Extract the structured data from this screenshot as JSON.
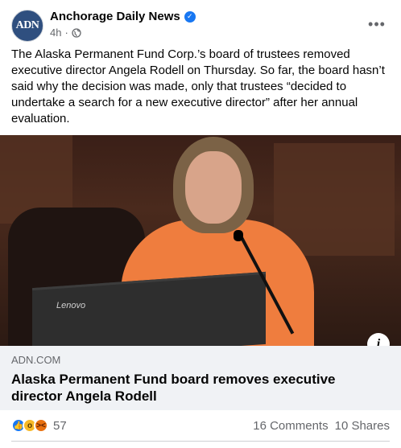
{
  "header": {
    "avatar_text": "ADN",
    "page_name": "Anchorage Daily News",
    "time": "4h",
    "separator": "·",
    "more_label": "•••"
  },
  "post": {
    "text": "The Alaska Permanent Fund Corp.’s board of trustees removed executive director Angela Rodell on Thursday. So far, the board hasn’t said why the decision was made, only that trustees “decided to undertake a search for a new executive director” after her annual evaluation."
  },
  "photo": {
    "laptop_brand": "Lenovo"
  },
  "link": {
    "domain": "ADN.COM",
    "title": "Alaska Permanent Fund board removes executive director Angela Rodell",
    "info_label": "i"
  },
  "footer": {
    "reaction_count": "57",
    "comments": "16 Comments",
    "shares": "10 Shares"
  },
  "colors": {
    "accent": "#1877f2",
    "secondary_text": "#65676b",
    "link_bg": "#f0f2f5"
  }
}
